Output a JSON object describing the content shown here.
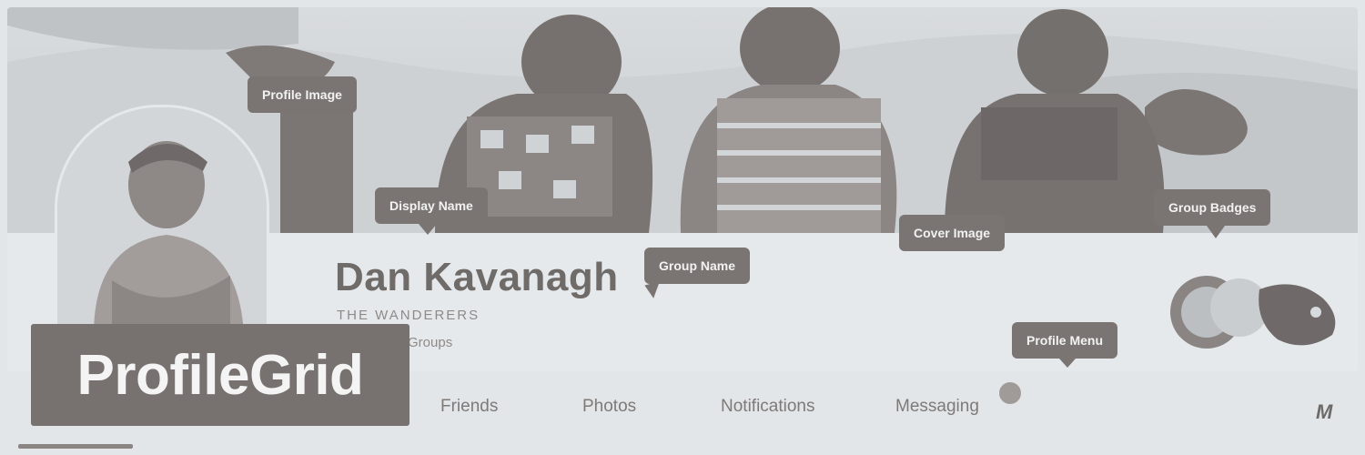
{
  "profile": {
    "display_name": "Dan Kavanagh",
    "group_name": "THE WANDERERS",
    "groups_text": "Groups"
  },
  "brand": {
    "logo_text": "ProfileGrid",
    "corner_mark": "M"
  },
  "menu": {
    "items": [
      "Friends",
      "Photos",
      "Notifications",
      "Messaging"
    ]
  },
  "callouts": {
    "profile_image": "Profile Image",
    "display_name": "Display Name",
    "group_name": "Group Name",
    "cover_image": "Cover Image",
    "group_badges": "Group Badges",
    "profile_menu": "Profile Menu"
  },
  "colors": {
    "callout_bg": "#7a7472",
    "logo_bg": "#777170",
    "page_bg": "#e3e6e8"
  },
  "icons": {
    "notification": "notification-dot-icon",
    "brand": "brand-mark-icon"
  }
}
